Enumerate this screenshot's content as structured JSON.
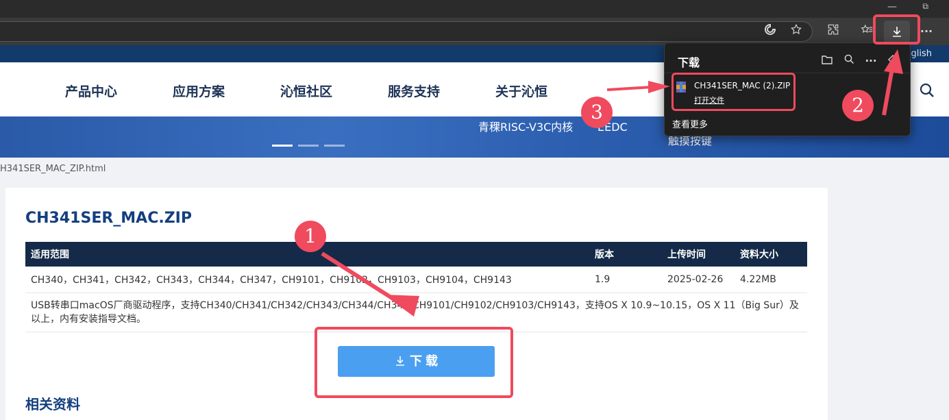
{
  "browser": {
    "window_min": "—",
    "window_max": "⧉",
    "more_label": "···"
  },
  "site": {
    "lang": "English",
    "nav": [
      "产品中心",
      "应用方案",
      "沁恒社区",
      "服务支持",
      "关于沁恒"
    ],
    "banner_text": [
      "青稞RISC-V3C内核",
      "EEDC",
      "触摸按键"
    ]
  },
  "url_crumb": "H341SER_MAC_ZIP.html",
  "page": {
    "title": "CH341SER_MAC.ZIP",
    "table": {
      "headers": [
        "适用范围",
        "版本",
        "上传时间",
        "资料大小"
      ],
      "row": [
        "CH340，CH341，CH342，CH343，CH344，CH347，CH9101，CH9102，CH9103，CH9104，CH9143",
        "1.9",
        "2025-02-26",
        "4.22MB"
      ],
      "description": "USB转串口macOS厂商驱动程序，支持CH340/CH341/CH342/CH343/CH344/CH347/CH9101/CH9102/CH9103/CH9143，支持OS X 10.9~10.15，OS X 11（Big Sur）及以上，内有安装指导文档。"
    },
    "download_label": "下 载",
    "related_title": "相关资料"
  },
  "download_panel": {
    "title": "下载",
    "file_name": "CH341SER_MAC (2).ZIP",
    "open_file": "打开文件",
    "view_more": "查看更多"
  },
  "annotations": [
    "1",
    "2",
    "3"
  ],
  "colors": {
    "accent_red": "#f04a5e",
    "nav_dark_blue": "#123a6b",
    "button_blue": "#4b9ff0",
    "table_header": "#142a48"
  }
}
